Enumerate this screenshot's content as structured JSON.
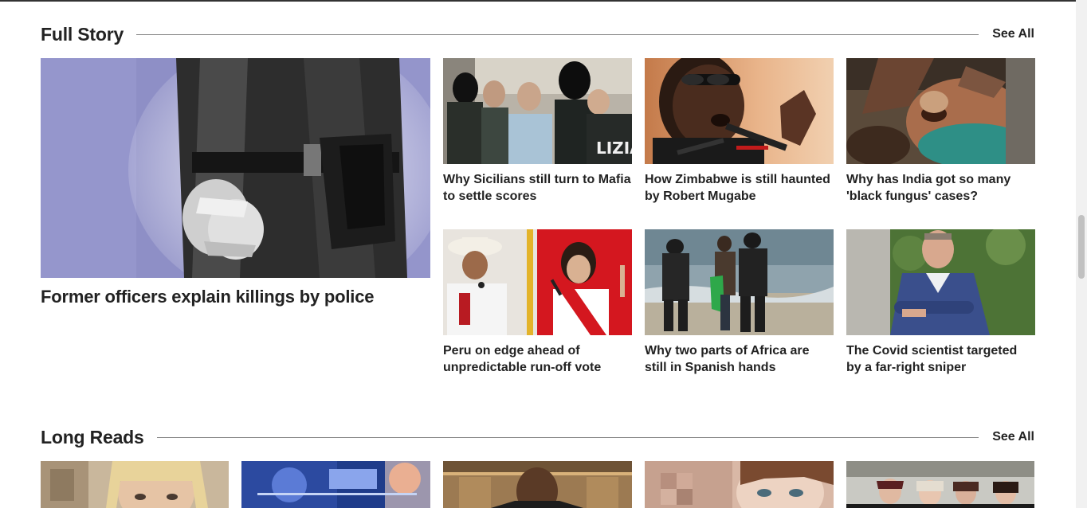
{
  "full_story": {
    "title": "Full Story",
    "see_all": "See All",
    "feature": {
      "title": "Former officers explain killings by police"
    },
    "cards": [
      {
        "title": "Why Sicilians still turn to Mafia to settle scores"
      },
      {
        "title": "How Zimbabwe is still haunted by Robert Mugabe"
      },
      {
        "title": "Why has India got so many 'black fungus' cases?"
      },
      {
        "title": "Peru on edge ahead of unpredictable run-off vote"
      },
      {
        "title": "Why two parts of Africa are still in Spanish hands"
      },
      {
        "title": "The Covid scientist targeted by a far-right sniper"
      }
    ]
  },
  "long_reads": {
    "title": "Long Reads",
    "see_all": "See All"
  },
  "colors": {
    "feature_bg": "#8e8fc6",
    "text": "#222222"
  }
}
